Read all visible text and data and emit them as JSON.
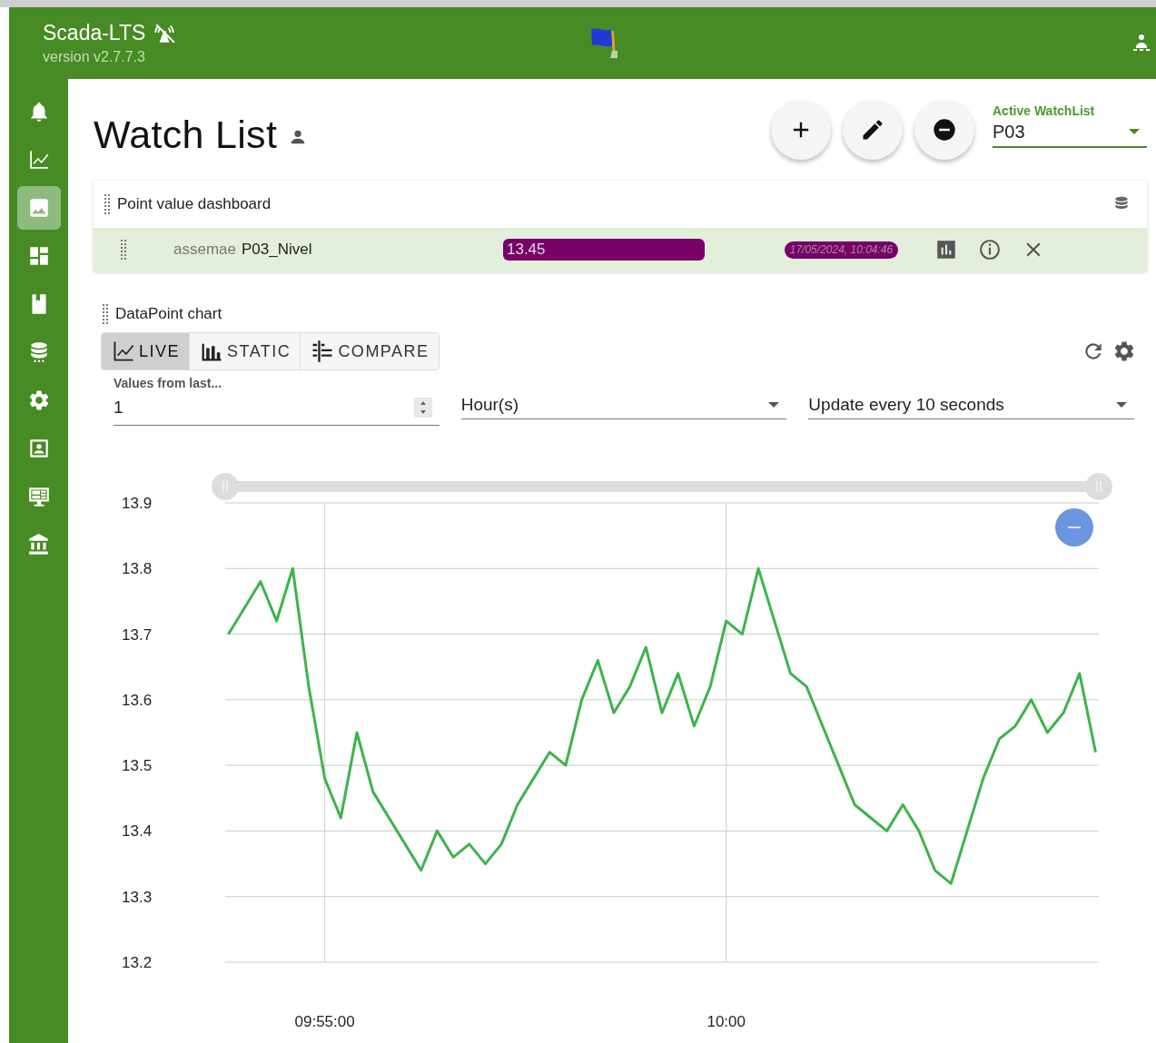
{
  "header": {
    "title": "Scada-LTS",
    "version": "version v2.7.7.3"
  },
  "sidebar": {
    "items": [
      {
        "kind": "bell",
        "selected": false
      },
      {
        "kind": "chart",
        "selected": false
      },
      {
        "kind": "image",
        "selected": true
      },
      {
        "kind": "dashboard",
        "selected": false
      },
      {
        "kind": "bookmark",
        "selected": false
      },
      {
        "kind": "database",
        "selected": false
      },
      {
        "kind": "settings",
        "selected": false
      },
      {
        "kind": "contact",
        "selected": false
      },
      {
        "kind": "monitor",
        "selected": false
      },
      {
        "kind": "bank",
        "selected": false
      }
    ]
  },
  "page": {
    "title": "Watch List"
  },
  "watchlist_select": {
    "label": "Active WatchList",
    "value": "P03"
  },
  "dashboard": {
    "title": "Point value dashboard",
    "points": [
      {
        "source": "assemae",
        "name": "P03_Nivel",
        "value": "13.45",
        "time": "17/05/2024, 10:04:46"
      }
    ]
  },
  "chart_panel": {
    "title": "DataPoint chart",
    "tabs": [
      {
        "kind": "live",
        "label": "LIVE",
        "selected": true
      },
      {
        "kind": "static",
        "label": "STATIC",
        "selected": false
      },
      {
        "kind": "compare",
        "label": "COMPARE",
        "selected": false
      }
    ],
    "period": {
      "label": "Values from last...",
      "value": "1"
    },
    "unit": {
      "value": "Hour(s)"
    },
    "refresh": {
      "value": "Update every 10 seconds"
    },
    "chart_data": {
      "type": "line",
      "grid": true,
      "ylim": [
        13.2,
        13.9
      ],
      "yticks": [
        13.2,
        13.3,
        13.4,
        13.5,
        13.6,
        13.7,
        13.8,
        13.9
      ],
      "categories": [
        null,
        null,
        null,
        null,
        null,
        null,
        "09:55:00",
        null,
        null,
        null,
        null,
        null,
        null,
        null,
        null,
        null,
        null,
        null,
        null,
        null,
        null,
        null,
        null,
        null,
        null,
        null,
        null,
        null,
        null,
        null,
        null,
        "10:00",
        null,
        null,
        null,
        null,
        null,
        null,
        null,
        null,
        null,
        null,
        null,
        null,
        null,
        null,
        null,
        null,
        null,
        null,
        null,
        null,
        null,
        null,
        null
      ],
      "series": [
        {
          "color": "#3cb44b",
          "values": [
            13.7,
            13.74,
            13.78,
            13.72,
            13.8,
            13.62,
            13.48,
            13.42,
            13.55,
            13.46,
            13.42,
            13.38,
            13.34,
            13.4,
            13.36,
            13.38,
            13.35,
            13.38,
            13.44,
            13.48,
            13.52,
            13.5,
            13.6,
            13.66,
            13.58,
            13.62,
            13.68,
            13.58,
            13.64,
            13.56,
            13.62,
            13.72,
            13.7,
            13.8,
            13.72,
            13.64,
            13.62,
            13.56,
            13.5,
            13.44,
            13.42,
            13.4,
            13.44,
            13.4,
            13.34,
            13.32,
            13.4,
            13.48,
            13.54,
            13.56,
            13.6,
            13.55,
            13.58,
            13.64,
            13.52
          ]
        }
      ]
    }
  }
}
